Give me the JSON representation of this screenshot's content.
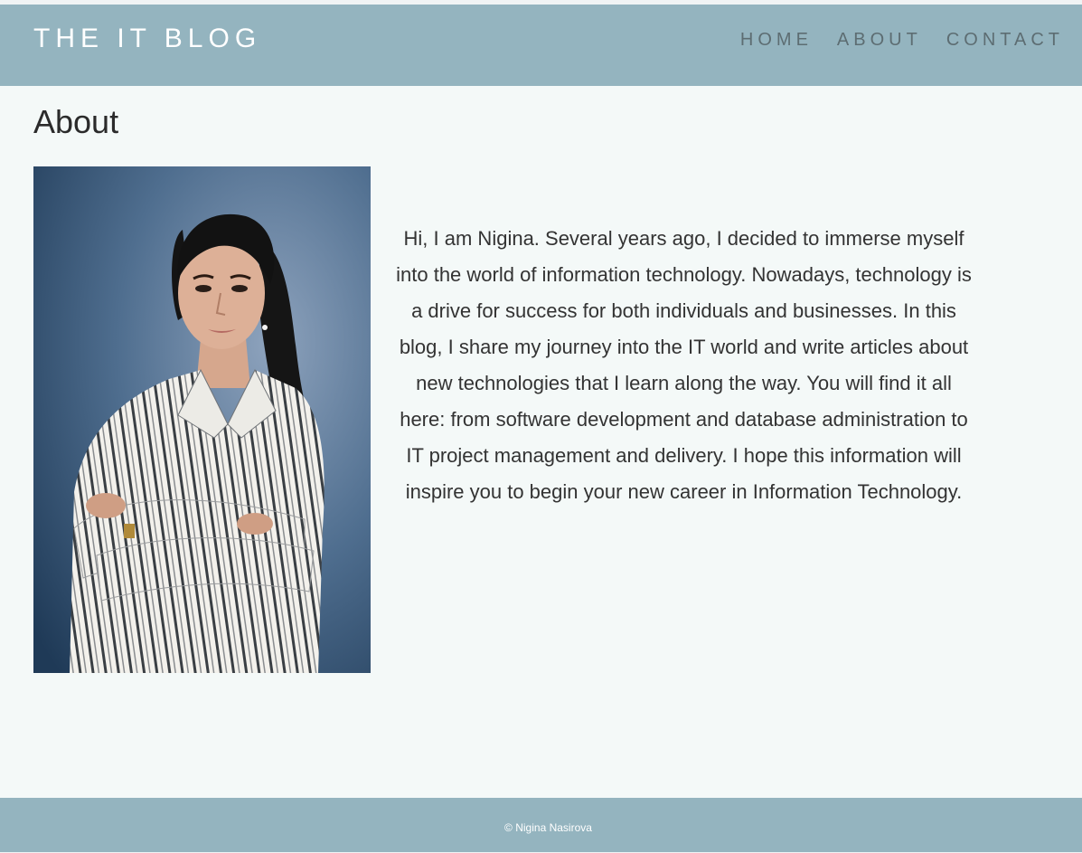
{
  "header": {
    "brand": "THE IT BLOG",
    "nav": [
      {
        "label": "HOME"
      },
      {
        "label": "ABOUT"
      },
      {
        "label": "CONTACT"
      }
    ]
  },
  "main": {
    "title": "About",
    "portrait_icon": "portrait-photo",
    "bio": "Hi, I am Nigina. Several years ago, I decided to immerse myself into the world of information technology. Nowadays, technology is a drive for success for both individuals and businesses. In this blog, I share my journey into the IT world and write articles about new technologies that I learn along the way. You will find it all here: from software development and database administration to IT project management and delivery. I hope this information will inspire you to begin your new career in Information Technology."
  },
  "footer": {
    "copyright": "© Nigina Nasirova"
  },
  "colors": {
    "header_bg": "#94b4bf",
    "page_bg": "#f4f9f8",
    "brand_text": "#ffffff",
    "nav_text": "#5d6d72",
    "body_text": "#333333"
  }
}
